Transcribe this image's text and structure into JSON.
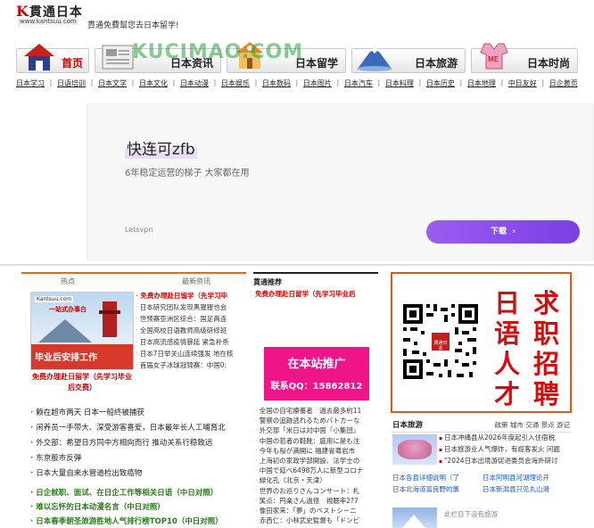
{
  "header": {
    "logo_text": "貫通日本",
    "logo_k": "K",
    "logo_url": "www.kantsuu.com",
    "slogan": "貫通免費幫您去日本留学!"
  },
  "nav": {
    "tabs": [
      {
        "label": "首页",
        "icon": "house-icon"
      },
      {
        "label": "日本资讯",
        "icon": "newspaper-icon"
      },
      {
        "label": "日本留学",
        "icon": "school-icon"
      },
      {
        "label": "日本旅游",
        "icon": "mount-fuji-icon"
      },
      {
        "label": "日本时尚",
        "icon": "fashion-icon"
      }
    ],
    "watermark": "KUCIMAO.COM"
  },
  "subnav": [
    "日本学习",
    "日语培训",
    "日本文学",
    "日本文化",
    "日本动漫",
    "日本娱乐",
    "日本数码",
    "日本图片",
    "日本汽车",
    "日本料理",
    "日本历史",
    "日本地理",
    "中日友好",
    "日企黄页"
  ],
  "ad": {
    "title": "快连可zfb",
    "subtitle": "6年稳定运营的梯子 大家都在用",
    "brand": "Letsvpn",
    "button": "下载",
    "button_icon": "chevron-right-icon",
    "accent": "#8a4ff0"
  },
  "left": {
    "tab_hot": "热点",
    "tab_latest": "最新资讯",
    "thumb": {
      "tag": "Kantsuu.com",
      "tag2": "一站式办事白",
      "band": "毕业后安排工作"
    },
    "thumb_caption": "免费办理赴日留学（先学习毕业后交费）",
    "list_a_hot": "免费办理赴日留学（先学习毕",
    "list_a": [
      "日本研究团队发现黑猩猩也会",
      "世预赛亚洲区综合：国足两连",
      "全国高校日语教师高级研修班",
      "日本高流感疫情暴延 紧急补杀",
      "日本7日举关山连续强发 地在核",
      "首届女子冰球冠锦赛：中国0:"
    ],
    "list_b": [
      "赖在超市两天 日本一船终被捕获",
      "闲养员一手带大、深受游客喜爱，日本最年长人工哺育北",
      "外交部：希望日方同中方相向而行 推动关系行稳致远",
      "东京股市反弹",
      "日本大量自来水管道检出致癌物"
    ],
    "list_c": [
      "日企就职、面试、在日企工作等相关日语（中日对照）",
      "难以忘怀的日本动漫名言（中日对照）",
      "日本春季朝圣旅游胜地人气排行榜TOP10（中日对照）"
    ]
  },
  "middle": {
    "head": "貫通推荐",
    "hot": "免费办理赴日留学（先学习毕业后",
    "promo_line1": "在本站推广",
    "promo_line2": "联系QQ：15862812",
    "list": [
      "全国の自宅療養者　過去最多約11",
      "警察の追跡逃れるためバトカーな",
      "外交部「米日は対中国『小集団』",
      "中国の若者の鞋靴：庭用に是も注",
      "今年も桜が満開に 福建省粤岩市",
      "上海初の家政学部開設、法学士の",
      "中国で延べ6498万人に新型コロナ",
      "緑化孔（北京・天津）",
      "世界のお巡りさんコンサート：札",
      "笑点：円楽さん過怪　視聴率2?7",
      "像田家来：「夢」のベストシーニ",
      "赤西仁：小林武史監督も「ドンビ"
    ]
  },
  "right": {
    "qr_label": "貫通日本",
    "jobs_chars": [
      "日",
      "语",
      "人",
      "才",
      "求",
      "职",
      "招",
      "聘"
    ],
    "travel_head": "日本旅游",
    "travel_tabs": "政策 城市 交通 景点 游记",
    "travel_list": [
      "日本冲绳县从2026年度起引入住宿税",
      "日本旅游业人气爆炸，有缆客发火 问题",
      "\"2024日本出境游促进委员会海外研讨"
    ],
    "travel_grid": [
      [
        "日本各县详细说明（了",
        "日本阿明县河湖理论开"
      ],
      [
        "日本北海道富良野的薰",
        "日本新潟县只见丸山滑"
      ]
    ],
    "travel_note": "此栏目下没有旅游"
  }
}
